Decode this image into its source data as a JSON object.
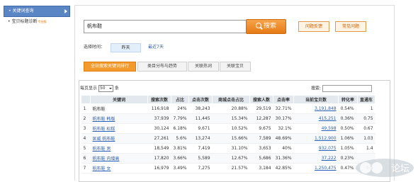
{
  "sidebar": {
    "items": [
      {
        "label": "• 关键词查询",
        "badge": ""
      },
      {
        "label": "• 宝贝标题诊断",
        "badge": "专业版"
      }
    ]
  },
  "search": {
    "value": "帆布鞋",
    "button_label": "搜索"
  },
  "feedback_buttons": [
    "问题反馈",
    "常见问题"
  ],
  "time": {
    "label": "选择时间：",
    "options": [
      "昨天",
      "最近7天"
    ]
  },
  "tabs": [
    "全站搜索关键词排行",
    "类目分布与趋势",
    "关联热词",
    "关联宝贝"
  ],
  "pagination": {
    "prefix": "每页显示",
    "value": "50",
    "suffix": "条"
  },
  "filter": {
    "label": "搜索:"
  },
  "table": {
    "headers": [
      "",
      "关键词",
      "搜索次数",
      "占比",
      "点击次数",
      "商城点击占比",
      "搜索人数",
      "点击率",
      "当前宝贝数",
      "转化率",
      "直通车"
    ],
    "rows": [
      {
        "idx": "1",
        "kw": "帆布鞋",
        "link": false,
        "searches": "116,918",
        "ratio": "24%",
        "clicks": "38,243",
        "mall": "20.88%",
        "users": "29,519",
        "ctr": "32.71%",
        "items": "3,191,848",
        "conv": "0.54%",
        "ztc": "1",
        "bar": 0.24
      },
      {
        "idx": "2",
        "kw": "帆布鞋 韩版",
        "link": true,
        "searches": "37,939",
        "ratio": "7.79%",
        "clicks": "11,445",
        "mall": "15.34%",
        "users": "12,287",
        "ctr": "30.17%",
        "items": "415,251",
        "conv": "0.36%",
        "ztc": "0.75",
        "bar": 0.0779
      },
      {
        "idx": "3",
        "kw": "帆布鞋 松糕",
        "link": true,
        "searches": "30,124",
        "ratio": "6.18%",
        "clicks": "9,671",
        "mall": "10.52%",
        "users": "9,675",
        "ctr": "32.1%",
        "items": "49,598",
        "conv": "0.50%",
        "ztc": "0.67",
        "bar": 0.0618
      },
      {
        "idx": "4",
        "kw": "匡威 帆布鞋",
        "link": true,
        "searches": "27,261",
        "ratio": "5.6%",
        "clicks": "13,274",
        "mall": "15.66%",
        "users": "7,589",
        "ctr": "48.69%",
        "items": "1,512,900",
        "conv": "1.06%",
        "ztc": "1.03",
        "bar": 0.056
      },
      {
        "idx": "5",
        "kw": "帆布鞋 男",
        "link": true,
        "searches": "18,549",
        "ratio": "3.81%",
        "clicks": "7,419",
        "mall": "31.10%",
        "users": "3,653",
        "ctr": "40%",
        "items": "932,075",
        "conv": "1.05%",
        "ztc": "1.4",
        "bar": 0.0381
      },
      {
        "idx": "6",
        "kw": "帆布鞋 内增高",
        "link": true,
        "searches": "17,820",
        "ratio": "3.66%",
        "clicks": "5,589",
        "mall": "12.67%",
        "users": "5,686",
        "ctr": "31.36%",
        "items": "37,222",
        "conv": "0.23%",
        "ztc": "",
        "bar": 0.0366
      },
      {
        "idx": "7",
        "kw": "帆布鞋 女",
        "link": true,
        "searches": "16,979",
        "ratio": "3.49%",
        "clicks": "7,275",
        "mall": "21.57%",
        "users": "3,184",
        "ctr": "42.85%",
        "items": "1,250,475",
        "conv": "0.47%",
        "ztc": "0.9",
        "bar": 0.0349
      }
    ]
  },
  "watermark": {
    "text": "论坛"
  }
}
